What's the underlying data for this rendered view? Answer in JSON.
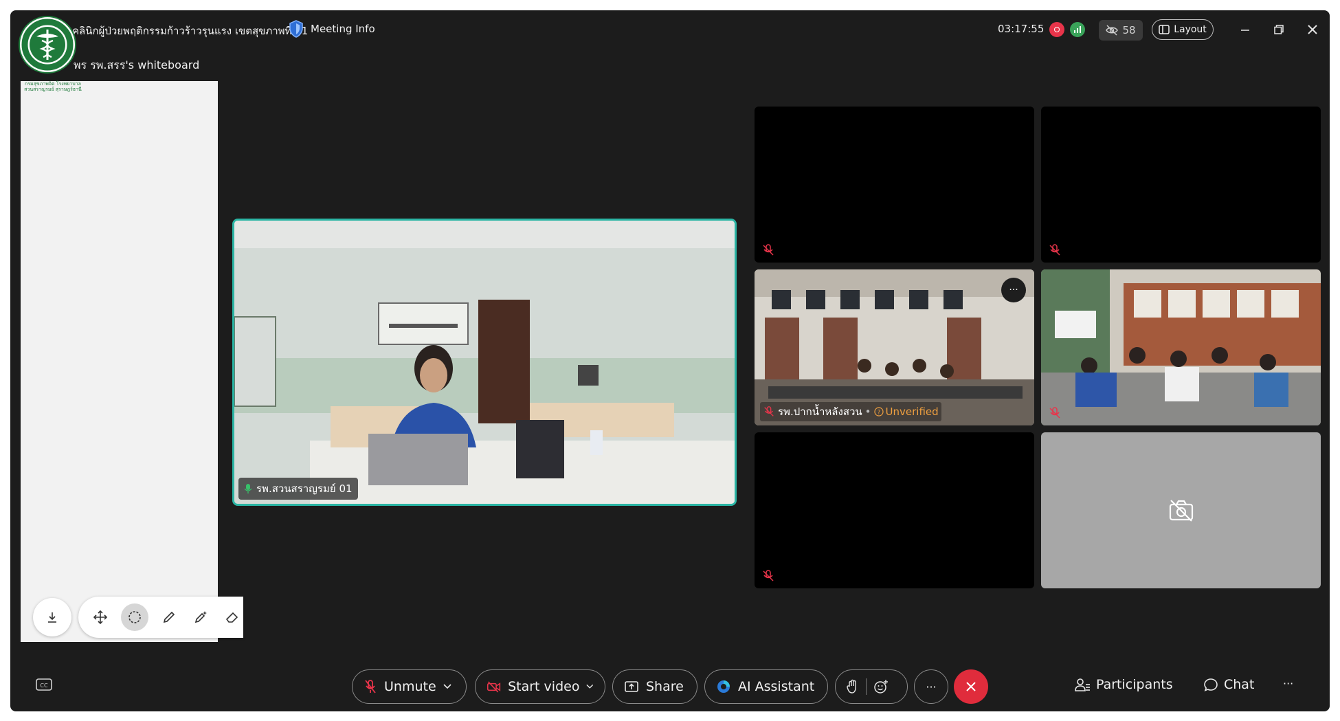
{
  "header": {
    "title": "คลินิกผู้ป่วยพฤติกรรมก้าวร้าวรุนแรง เขตสุขภาพที่ 11",
    "meeting_info": "Meeting Info",
    "timer": "03:17:55",
    "hidden_participants": "58",
    "layout_label": "Layout"
  },
  "whiteboard": {
    "label": "พร รพ.สรร's whiteboard",
    "logo_text": "กรมสุขภาพจิต โรงพยาบาลสวนสราญรมย์ สุราษฎร์ธานี"
  },
  "active_speaker": {
    "name": "รพ.สวนสราญรมย์ 01"
  },
  "tiles": [
    {
      "name": "",
      "video": "black"
    },
    {
      "name": "",
      "video": "black"
    },
    {
      "name": "รพ.ปากน้ำหลังสวน",
      "status": "Unverified",
      "video": "meeting-room"
    },
    {
      "name": "",
      "video": "classroom"
    },
    {
      "name": "",
      "video": "black"
    },
    {
      "name": "",
      "video": "camera-off"
    }
  ],
  "controls": {
    "unmute": "Unmute",
    "start_video": "Start video",
    "share": "Share",
    "ai_assistant": "AI Assistant",
    "participants": "Participants",
    "chat": "Chat",
    "more": "···"
  },
  "colors": {
    "background": "#1c1c1c",
    "active_border": "#2ab5a4",
    "end_call": "#e02c3c",
    "mute_red": "#e8344a",
    "unverified": "#f0a040"
  }
}
